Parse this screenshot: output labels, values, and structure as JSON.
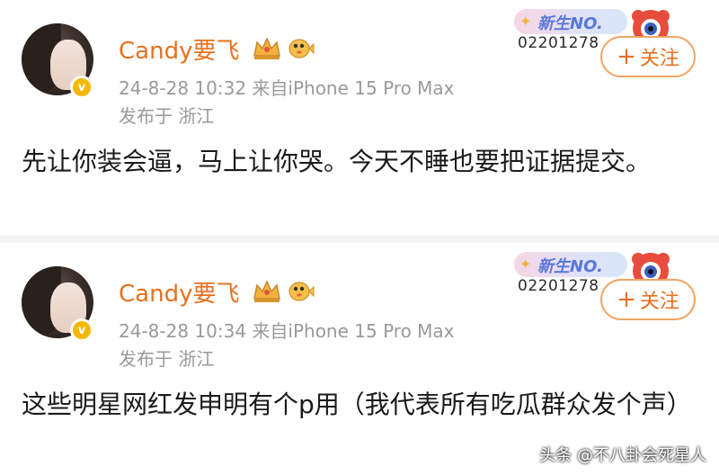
{
  "posts": [
    {
      "username": "Candy要飞",
      "verified_mark": "v",
      "meta": "24-8-28 10:32  来自iPhone 15 Pro Max",
      "location": "发布于 浙江",
      "content": "先让你装会逼，马上让你哭。今天不睡也要把证据提交。",
      "badge_title": "新生NO.",
      "badge_number": "02201278",
      "follow_plus": "+",
      "follow_label": "关注",
      "icons": [
        "crown-icon",
        "pufferfish-icon",
        "mascot-icon"
      ]
    },
    {
      "username": "Candy要飞",
      "verified_mark": "v",
      "meta": "24-8-28 10:34  来自iPhone 15 Pro Max",
      "location": "发布于 浙江",
      "content": "这些明星网红发申明有个p用（我代表所有吃瓜群众发个声）",
      "badge_title": "新生NO.",
      "badge_number": "02201278",
      "follow_plus": "+",
      "follow_label": "关注",
      "icons": [
        "crown-icon",
        "pufferfish-icon",
        "mascot-icon"
      ]
    }
  ],
  "watermark": "头条 @不八卦会死星人",
  "colors": {
    "username": "#e8701f",
    "meta_text": "#9a9a9a",
    "follow_border": "#f1a664",
    "badge_text": "#5b78d8",
    "verified_badge": "#f5b800",
    "separator": "#f3f3f3"
  }
}
